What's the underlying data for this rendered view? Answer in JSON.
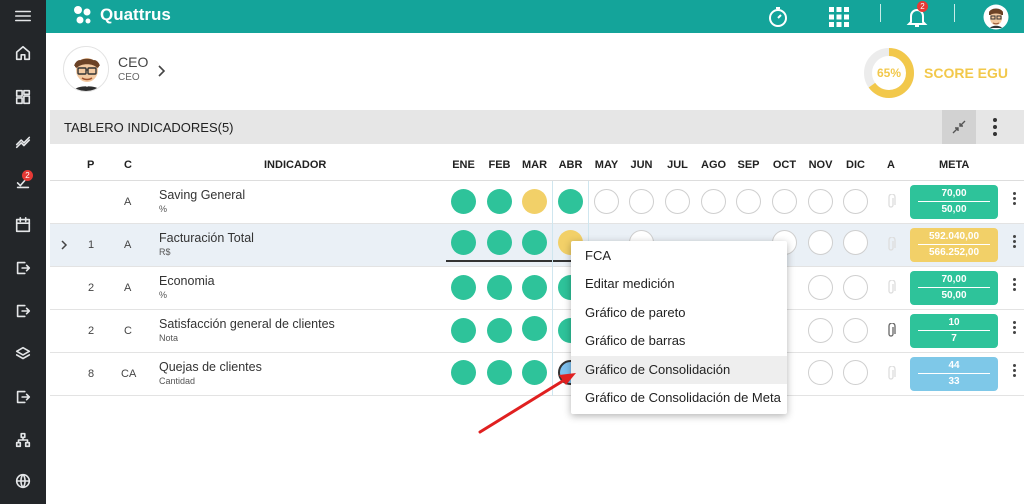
{
  "brand": {
    "name": "Quattrus"
  },
  "topbar": {
    "notification_count": "2"
  },
  "sidebar": {
    "badge_count": "2"
  },
  "profile": {
    "title": "CEO",
    "subtitle": "CEO"
  },
  "score": {
    "percent_label": "65%",
    "percent": 65,
    "label": "SCORE EGU",
    "color": "#f2c84b"
  },
  "panel": {
    "title": "TABLERO INDICADORES(5)"
  },
  "columns": {
    "p": "P",
    "c": "C",
    "indicator": "INDICADOR",
    "months": [
      "ENE",
      "FEB",
      "MAR",
      "ABR",
      "MAY",
      "JUN",
      "JUL",
      "AGO",
      "SEP",
      "OCT",
      "NOV",
      "DIC"
    ],
    "a": "A",
    "meta": "META"
  },
  "rows": [
    {
      "p": "",
      "c": "A",
      "name": "Saving General",
      "unit": "%",
      "meta_top": "70,00",
      "meta_bottom": "50,00"
    },
    {
      "p": "1",
      "c": "A",
      "name": "Facturación Total",
      "unit": "R$",
      "meta_top": "592.040,00",
      "meta_bottom": "566.252,00"
    },
    {
      "p": "2",
      "c": "A",
      "name": "Economia",
      "unit": "%",
      "meta_top": "70,00",
      "meta_bottom": "50,00"
    },
    {
      "p": "2",
      "c": "C",
      "name": "Satisfacción general de clientes",
      "unit": "Nota",
      "meta_top": "10",
      "meta_bottom": "7"
    },
    {
      "p": "8",
      "c": "CA",
      "name": "Quejas de clientes",
      "unit": "Cantidad",
      "meta_top": "44",
      "meta_bottom": "33"
    }
  ],
  "context_menu": {
    "items": [
      "FCA",
      "Editar medición",
      "Gráfico de pareto",
      "Gráfico de barras",
      "Gráfico de Consolidación",
      "Gráfico de Consolidación de Meta"
    ]
  },
  "colors": {
    "teal": "#14a49a",
    "green": "#2ec39a",
    "yellow": "#f2d068",
    "blue": "#7ec8e8",
    "arrow": "#e02020"
  }
}
